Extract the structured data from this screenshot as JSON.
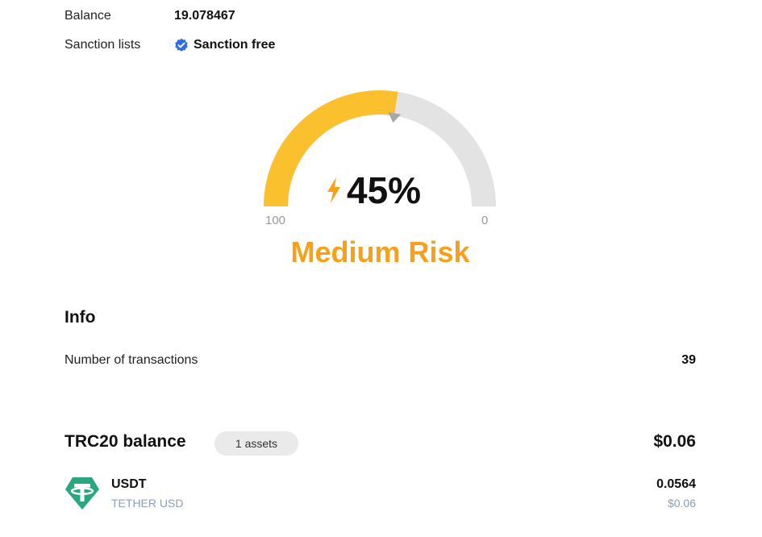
{
  "summary": {
    "balance_label": "Balance",
    "balance_value": "19.078467",
    "sanction_label": "Sanction lists",
    "sanction_value": "Sanction free"
  },
  "risk": {
    "level_fraction": 0.45,
    "percent_text": "45%",
    "scale_min": "0",
    "scale_max": "100",
    "label": "Medium Risk",
    "fill_color": "#fbc02d",
    "track_color": "#e3e3e3",
    "label_color": "#f7a11b"
  },
  "info": {
    "title": "Info",
    "transactions_label": "Number of transactions",
    "transactions_value": "39"
  },
  "trc20": {
    "title": "TRC20 balance",
    "assets_badge": "1 assets",
    "total": "$0.06",
    "tokens": [
      {
        "icon": "tether-icon",
        "symbol": "USDT",
        "name": "TETHER USD",
        "amount": "0.0564",
        "usd": "$0.06"
      }
    ]
  },
  "colors": {
    "verified_blue": "#2f6de1",
    "tether_green": "#2aa77f",
    "muted_text": "#8aa0b8"
  }
}
